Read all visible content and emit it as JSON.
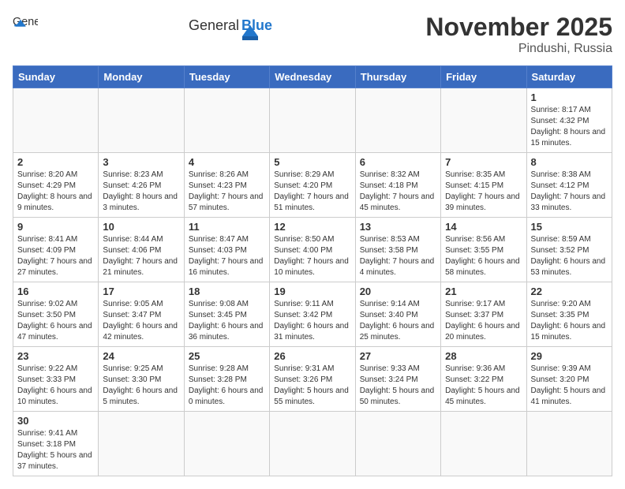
{
  "header": {
    "logo_general": "General",
    "logo_blue": "Blue",
    "month_year": "November 2025",
    "location": "Pindushi, Russia"
  },
  "days_of_week": [
    "Sunday",
    "Monday",
    "Tuesday",
    "Wednesday",
    "Thursday",
    "Friday",
    "Saturday"
  ],
  "weeks": [
    [
      {
        "day": "",
        "info": ""
      },
      {
        "day": "",
        "info": ""
      },
      {
        "day": "",
        "info": ""
      },
      {
        "day": "",
        "info": ""
      },
      {
        "day": "",
        "info": ""
      },
      {
        "day": "",
        "info": ""
      },
      {
        "day": "1",
        "info": "Sunrise: 8:17 AM\nSunset: 4:32 PM\nDaylight: 8 hours and 15 minutes."
      }
    ],
    [
      {
        "day": "2",
        "info": "Sunrise: 8:20 AM\nSunset: 4:29 PM\nDaylight: 8 hours and 9 minutes."
      },
      {
        "day": "3",
        "info": "Sunrise: 8:23 AM\nSunset: 4:26 PM\nDaylight: 8 hours and 3 minutes."
      },
      {
        "day": "4",
        "info": "Sunrise: 8:26 AM\nSunset: 4:23 PM\nDaylight: 7 hours and 57 minutes."
      },
      {
        "day": "5",
        "info": "Sunrise: 8:29 AM\nSunset: 4:20 PM\nDaylight: 7 hours and 51 minutes."
      },
      {
        "day": "6",
        "info": "Sunrise: 8:32 AM\nSunset: 4:18 PM\nDaylight: 7 hours and 45 minutes."
      },
      {
        "day": "7",
        "info": "Sunrise: 8:35 AM\nSunset: 4:15 PM\nDaylight: 7 hours and 39 minutes."
      },
      {
        "day": "8",
        "info": "Sunrise: 8:38 AM\nSunset: 4:12 PM\nDaylight: 7 hours and 33 minutes."
      }
    ],
    [
      {
        "day": "9",
        "info": "Sunrise: 8:41 AM\nSunset: 4:09 PM\nDaylight: 7 hours and 27 minutes."
      },
      {
        "day": "10",
        "info": "Sunrise: 8:44 AM\nSunset: 4:06 PM\nDaylight: 7 hours and 21 minutes."
      },
      {
        "day": "11",
        "info": "Sunrise: 8:47 AM\nSunset: 4:03 PM\nDaylight: 7 hours and 16 minutes."
      },
      {
        "day": "12",
        "info": "Sunrise: 8:50 AM\nSunset: 4:00 PM\nDaylight: 7 hours and 10 minutes."
      },
      {
        "day": "13",
        "info": "Sunrise: 8:53 AM\nSunset: 3:58 PM\nDaylight: 7 hours and 4 minutes."
      },
      {
        "day": "14",
        "info": "Sunrise: 8:56 AM\nSunset: 3:55 PM\nDaylight: 6 hours and 58 minutes."
      },
      {
        "day": "15",
        "info": "Sunrise: 8:59 AM\nSunset: 3:52 PM\nDaylight: 6 hours and 53 minutes."
      }
    ],
    [
      {
        "day": "16",
        "info": "Sunrise: 9:02 AM\nSunset: 3:50 PM\nDaylight: 6 hours and 47 minutes."
      },
      {
        "day": "17",
        "info": "Sunrise: 9:05 AM\nSunset: 3:47 PM\nDaylight: 6 hours and 42 minutes."
      },
      {
        "day": "18",
        "info": "Sunrise: 9:08 AM\nSunset: 3:45 PM\nDaylight: 6 hours and 36 minutes."
      },
      {
        "day": "19",
        "info": "Sunrise: 9:11 AM\nSunset: 3:42 PM\nDaylight: 6 hours and 31 minutes."
      },
      {
        "day": "20",
        "info": "Sunrise: 9:14 AM\nSunset: 3:40 PM\nDaylight: 6 hours and 25 minutes."
      },
      {
        "day": "21",
        "info": "Sunrise: 9:17 AM\nSunset: 3:37 PM\nDaylight: 6 hours and 20 minutes."
      },
      {
        "day": "22",
        "info": "Sunrise: 9:20 AM\nSunset: 3:35 PM\nDaylight: 6 hours and 15 minutes."
      }
    ],
    [
      {
        "day": "23",
        "info": "Sunrise: 9:22 AM\nSunset: 3:33 PM\nDaylight: 6 hours and 10 minutes."
      },
      {
        "day": "24",
        "info": "Sunrise: 9:25 AM\nSunset: 3:30 PM\nDaylight: 6 hours and 5 minutes."
      },
      {
        "day": "25",
        "info": "Sunrise: 9:28 AM\nSunset: 3:28 PM\nDaylight: 6 hours and 0 minutes."
      },
      {
        "day": "26",
        "info": "Sunrise: 9:31 AM\nSunset: 3:26 PM\nDaylight: 5 hours and 55 minutes."
      },
      {
        "day": "27",
        "info": "Sunrise: 9:33 AM\nSunset: 3:24 PM\nDaylight: 5 hours and 50 minutes."
      },
      {
        "day": "28",
        "info": "Sunrise: 9:36 AM\nSunset: 3:22 PM\nDaylight: 5 hours and 45 minutes."
      },
      {
        "day": "29",
        "info": "Sunrise: 9:39 AM\nSunset: 3:20 PM\nDaylight: 5 hours and 41 minutes."
      }
    ],
    [
      {
        "day": "30",
        "info": "Sunrise: 9:41 AM\nSunset: 3:18 PM\nDaylight: 5 hours and 37 minutes."
      },
      {
        "day": "",
        "info": ""
      },
      {
        "day": "",
        "info": ""
      },
      {
        "day": "",
        "info": ""
      },
      {
        "day": "",
        "info": ""
      },
      {
        "day": "",
        "info": ""
      },
      {
        "day": "",
        "info": ""
      }
    ]
  ]
}
